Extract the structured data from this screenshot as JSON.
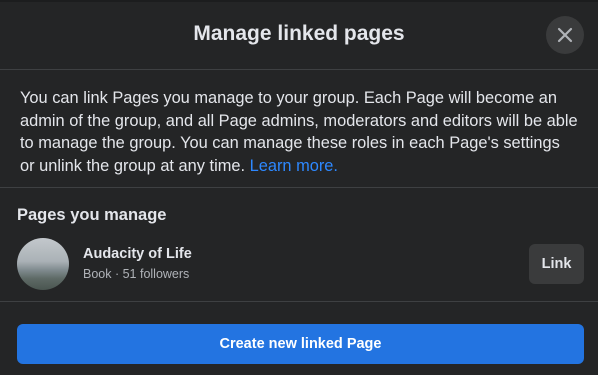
{
  "dialog": {
    "title": "Manage linked pages",
    "close_icon": "close-icon",
    "intro_text": "You can link Pages you manage to your group. Each Page will become an admin of the group, and all Page admins, moderators and editors will be able to manage the group. You can manage these roles in each Page's settings or unlink the group at any time.",
    "learn_more": "Learn more."
  },
  "pages_section": {
    "title": "Pages you manage",
    "items": [
      {
        "name": "Audacity of Life",
        "meta": "Book · 51 followers",
        "link_label": "Link"
      }
    ]
  },
  "footer": {
    "create_label": "Create new linked Page"
  },
  "colors": {
    "background": "#242526",
    "accent": "#2374e1",
    "link_text": "#2d88ff",
    "secondary_button": "#3a3b3c"
  }
}
